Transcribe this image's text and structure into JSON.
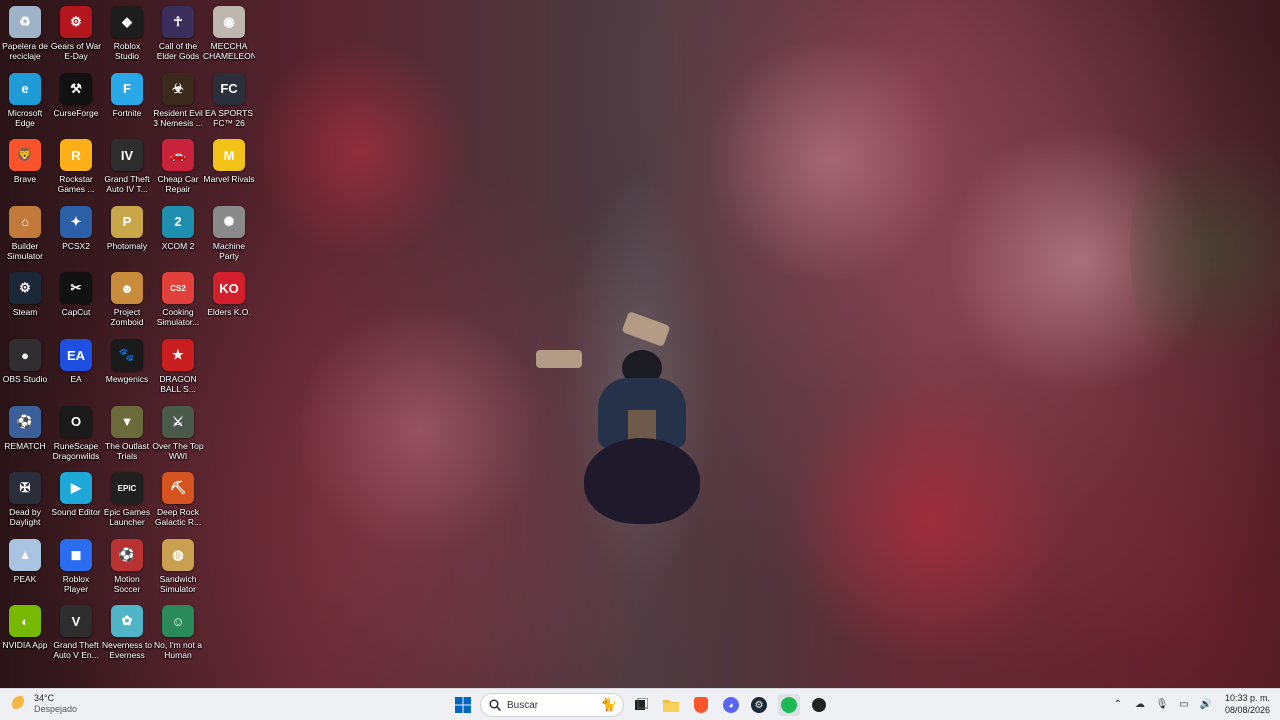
{
  "desktop": {
    "icons": [
      {
        "label": "Papelera de reciclaje",
        "icon": "recycle-bin-icon",
        "color": "#9fb3c8"
      },
      {
        "label": "Gears of War E-Day",
        "icon": "gears-of-war-icon",
        "color": "#b3161d"
      },
      {
        "label": "Roblox Studio",
        "icon": "roblox-studio-icon",
        "color": "#1d1d1d"
      },
      {
        "label": "Call of the Elder Gods",
        "icon": "elder-gods-icon",
        "color": "#3a2e5c"
      },
      {
        "label": "MECCHA CHAMELEON",
        "icon": "meccha-chameleon-icon",
        "color": "#bdb7b0"
      },
      {
        "label": "Microsoft Edge",
        "icon": "edge-icon",
        "color": "#1f9bd6"
      },
      {
        "label": "CurseForge",
        "icon": "curseforge-icon",
        "color": "#111111"
      },
      {
        "label": "Fortnite",
        "icon": "fortnite-icon",
        "color": "#2aa9e8"
      },
      {
        "label": "Resident Evil 3 Nemesis ...",
        "icon": "resident-evil-icon",
        "color": "#3b2a1c"
      },
      {
        "label": "EA SPORTS FC™ 26",
        "icon": "ea-fc-icon",
        "color": "#2b2f3a"
      },
      {
        "label": "Brave",
        "icon": "brave-icon",
        "color": "#fb542b"
      },
      {
        "label": "Rockstar Games ...",
        "icon": "rockstar-icon",
        "color": "#fcaf17"
      },
      {
        "label": "Grand Theft Auto IV T...",
        "icon": "gta-iv-icon",
        "color": "#2d2d2d"
      },
      {
        "label": "Cheap Car Repair",
        "icon": "cheap-car-repair-icon",
        "color": "#c8233a"
      },
      {
        "label": "Marvel Rivals",
        "icon": "marvel-rivals-icon",
        "color": "#f2c218"
      },
      {
        "label": "Builder Simulator",
        "icon": "builder-simulator-icon",
        "color": "#c27a3a"
      },
      {
        "label": "PCSX2",
        "icon": "pcsx2-icon",
        "color": "#2b5fa8"
      },
      {
        "label": "Photomaly",
        "icon": "photomaly-icon",
        "color": "#c9a64a"
      },
      {
        "label": "XCOM 2",
        "icon": "xcom2-icon",
        "color": "#1f8fb0"
      },
      {
        "label": "Machine Party",
        "icon": "machine-party-icon",
        "color": "#8a8a8a"
      },
      {
        "label": "Steam",
        "icon": "steam-icon",
        "color": "#1b2838"
      },
      {
        "label": "CapCut",
        "icon": "capcut-icon",
        "color": "#111111"
      },
      {
        "label": "Project Zomboid",
        "icon": "project-zomboid-icon",
        "color": "#c98c3a"
      },
      {
        "label": "Cooking Simulator...",
        "icon": "cooking-simulator-icon",
        "color": "#e2403a"
      },
      {
        "label": "Elders K.O.",
        "icon": "elders-ko-icon",
        "color": "#d21f2b"
      },
      {
        "label": "OBS Studio",
        "icon": "obs-icon",
        "color": "#302e31"
      },
      {
        "label": "EA",
        "icon": "ea-icon",
        "color": "#1f4fe0"
      },
      {
        "label": "Mewgenics",
        "icon": "mewgenics-icon",
        "color": "#1a1a1a"
      },
      {
        "label": "DRAGON BALL S...",
        "icon": "dragon-ball-icon",
        "color": "#c81e1e"
      },
      {
        "label": "",
        "icon": "blank-icon",
        "color": "rgba(0,0,0,0)"
      },
      {
        "label": "REMATCH",
        "icon": "rematch-icon",
        "color": "#3b5f9a"
      },
      {
        "label": "RuneScape Dragonwilds",
        "icon": "runescape-icon",
        "color": "#1a1a1a"
      },
      {
        "label": "The Outlast Trials",
        "icon": "outlast-trials-icon",
        "color": "#6a6a3a"
      },
      {
        "label": "Over The Top WWI",
        "icon": "over-the-top-icon",
        "color": "#4a5a4a"
      },
      {
        "label": "",
        "icon": "blank-icon",
        "color": "rgba(0,0,0,0)"
      },
      {
        "label": "Dead by Daylight",
        "icon": "dead-by-daylight-icon",
        "color": "#2a2e3a"
      },
      {
        "label": "Sound Editor",
        "icon": "sound-editor-icon",
        "color": "#1ea8d8"
      },
      {
        "label": "Epic Games Launcher",
        "icon": "epic-games-icon",
        "color": "#202020"
      },
      {
        "label": "Deep Rock Galactic R...",
        "icon": "deep-rock-icon",
        "color": "#d4531f"
      },
      {
        "label": "",
        "icon": "blank-icon",
        "color": "rgba(0,0,0,0)"
      },
      {
        "label": "PEAK",
        "icon": "peak-icon",
        "color": "#a9c4e0"
      },
      {
        "label": "Roblox Player",
        "icon": "roblox-player-icon",
        "color": "#2b6df0"
      },
      {
        "label": "Motion Soccer",
        "icon": "motion-soccer-icon",
        "color": "#b83232"
      },
      {
        "label": "Sandwich Simulator",
        "icon": "sandwich-simulator-icon",
        "color": "#c8a050"
      },
      {
        "label": "",
        "icon": "blank-icon",
        "color": "rgba(0,0,0,0)"
      },
      {
        "label": "NVIDIA App",
        "icon": "nvidia-icon",
        "color": "#76b900"
      },
      {
        "label": "Grand Theft Auto V En...",
        "icon": "gta-v-icon",
        "color": "#2d2d2d"
      },
      {
        "label": "Neverness to Everness",
        "icon": "neverness-icon",
        "color": "#4fb6c8"
      },
      {
        "label": "No, I'm not a Human",
        "icon": "not-a-human-icon",
        "color": "#2a8a5a"
      },
      {
        "label": "",
        "icon": "blank-icon",
        "color": "rgba(0,0,0,0)"
      }
    ],
    "glyphs": {
      "recycle-bin-icon": "♻",
      "gears-of-war-icon": "⚙",
      "roblox-studio-icon": "◆",
      "elder-gods-icon": "☥",
      "meccha-chameleon-icon": "◉",
      "edge-icon": "e",
      "curseforge-icon": "⚒",
      "fortnite-icon": "F",
      "resident-evil-icon": "☣",
      "ea-fc-icon": "FC",
      "brave-icon": "🦁",
      "rockstar-icon": "R",
      "gta-iv-icon": "IV",
      "cheap-car-repair-icon": "🚗",
      "marvel-rivals-icon": "M",
      "builder-simulator-icon": "⌂",
      "pcsx2-icon": "✦",
      "photomaly-icon": "P",
      "xcom2-icon": "2",
      "machine-party-icon": "✺",
      "steam-icon": "⚙",
      "capcut-icon": "✂",
      "project-zomboid-icon": "☻",
      "cooking-simulator-icon": "CS2",
      "elders-ko-icon": "KO",
      "obs-icon": "●",
      "ea-icon": "EA",
      "mewgenics-icon": "🐾",
      "dragon-ball-icon": "★",
      "blank-icon": "",
      "rematch-icon": "⚽",
      "runescape-icon": "O",
      "outlast-trials-icon": "▼",
      "over-the-top-icon": "⚔",
      "dead-by-daylight-icon": "✠",
      "sound-editor-icon": "▶",
      "epic-games-icon": "EPIC",
      "deep-rock-icon": "⛏",
      "peak-icon": "▲",
      "roblox-player-icon": "◼",
      "motion-soccer-icon": "⚽",
      "sandwich-simulator-icon": "◍",
      "nvidia-icon": "◐",
      "gta-v-icon": "V",
      "neverness-icon": "✿",
      "not-a-human-icon": "☺"
    }
  },
  "taskbar": {
    "weather": {
      "temp": "34°C",
      "desc": "Despejado"
    },
    "search_placeholder": "Buscar",
    "pinned": [
      {
        "name": "start-button",
        "icon": "windows-logo-icon",
        "color": "#0067c0"
      },
      {
        "name": "task-view-button",
        "icon": "task-view-icon",
        "color": "#222222"
      },
      {
        "name": "file-explorer-button",
        "icon": "folder-icon",
        "color": "#f2c041"
      },
      {
        "name": "brave-taskbar-button",
        "icon": "brave-icon",
        "color": "#fb542b"
      },
      {
        "name": "discord-taskbar-button",
        "icon": "discord-icon",
        "color": "#5865f2"
      },
      {
        "name": "steam-taskbar-button",
        "icon": "steam-icon",
        "color": "#1b2838"
      },
      {
        "name": "spotify-taskbar-button",
        "icon": "spotify-icon",
        "color": "#1db954"
      },
      {
        "name": "app-taskbar-button",
        "icon": "globe-icon",
        "color": "#222222"
      }
    ],
    "clock": {
      "time": "10:33 p. m.",
      "date": "08/08/2026"
    }
  }
}
